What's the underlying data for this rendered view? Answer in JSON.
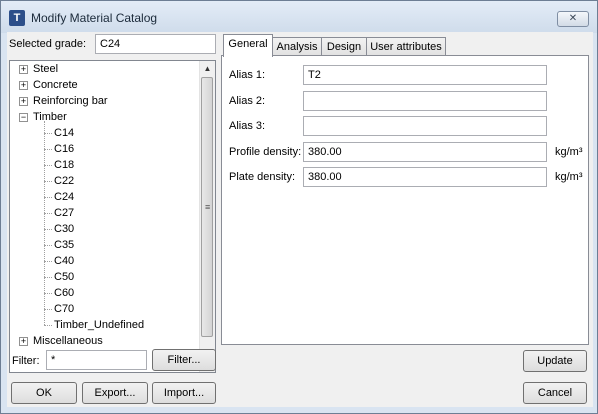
{
  "window": {
    "title": "Modify Material Catalog",
    "close_symbol": "✕"
  },
  "selected_grade": {
    "label": "Selected grade:",
    "value": "C24"
  },
  "tree": {
    "expand_symbol": "+",
    "collapse_symbol": "−",
    "categories": [
      {
        "label": "Steel",
        "expanded": false
      },
      {
        "label": "Concrete",
        "expanded": false
      },
      {
        "label": "Reinforcing bar",
        "expanded": false
      },
      {
        "label": "Timber",
        "expanded": true,
        "children": [
          "C14",
          "C16",
          "C18",
          "C22",
          "C24",
          "C27",
          "C30",
          "C35",
          "C40",
          "C50",
          "C60",
          "C70",
          "Timber_Undefined"
        ]
      },
      {
        "label": "Miscellaneous",
        "expanded": false
      }
    ]
  },
  "filter": {
    "label": "Filter:",
    "value": "*",
    "button": "Filter..."
  },
  "tabs": [
    "General",
    "Analysis",
    "Design",
    "User attributes"
  ],
  "general": {
    "fields": [
      {
        "label": "Alias 1:",
        "value": "T2",
        "unit": ""
      },
      {
        "label": "Alias 2:",
        "value": "",
        "unit": ""
      },
      {
        "label": "Alias 3:",
        "value": "",
        "unit": ""
      },
      {
        "label": "Profile density:",
        "value": "380.00",
        "unit": "kg/m³"
      },
      {
        "label": "Plate density:",
        "value": "380.00",
        "unit": "kg/m³"
      }
    ]
  },
  "buttons": {
    "update": "Update",
    "ok": "OK",
    "export": "Export...",
    "import": "Import...",
    "cancel": "Cancel"
  }
}
